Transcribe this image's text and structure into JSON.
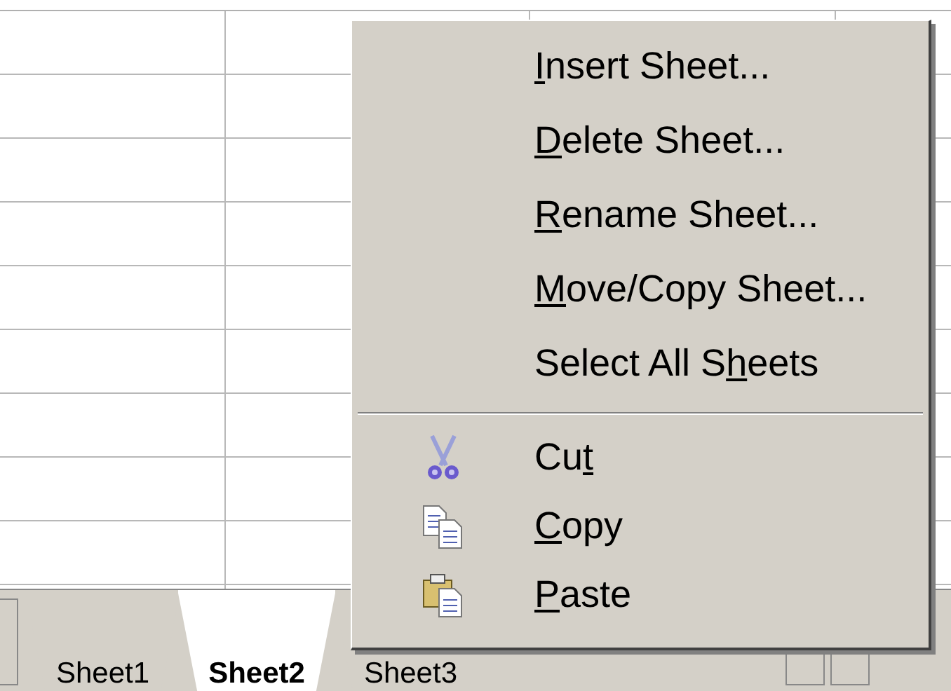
{
  "sheet_tabs": [
    {
      "label": "Sheet1",
      "selected": false
    },
    {
      "label": "Sheet2",
      "selected": true
    },
    {
      "label": "Sheet3",
      "selected": false
    }
  ],
  "context_menu": {
    "groups": [
      [
        {
          "key": "I",
          "after": "nsert Sheet..."
        },
        {
          "key": "D",
          "after": "elete Sheet..."
        },
        {
          "key": "R",
          "after": "ename Sheet..."
        },
        {
          "key": "M",
          "after": "ove/Copy Sheet..."
        },
        {
          "before": "Select All S",
          "key": "h",
          "after": "eets"
        }
      ],
      [
        {
          "kind": "cut",
          "before": "Cu",
          "key": "t"
        },
        {
          "kind": "copy",
          "key": "C",
          "after": "opy"
        },
        {
          "kind": "paste",
          "key": "P",
          "after": "aste"
        }
      ]
    ]
  }
}
